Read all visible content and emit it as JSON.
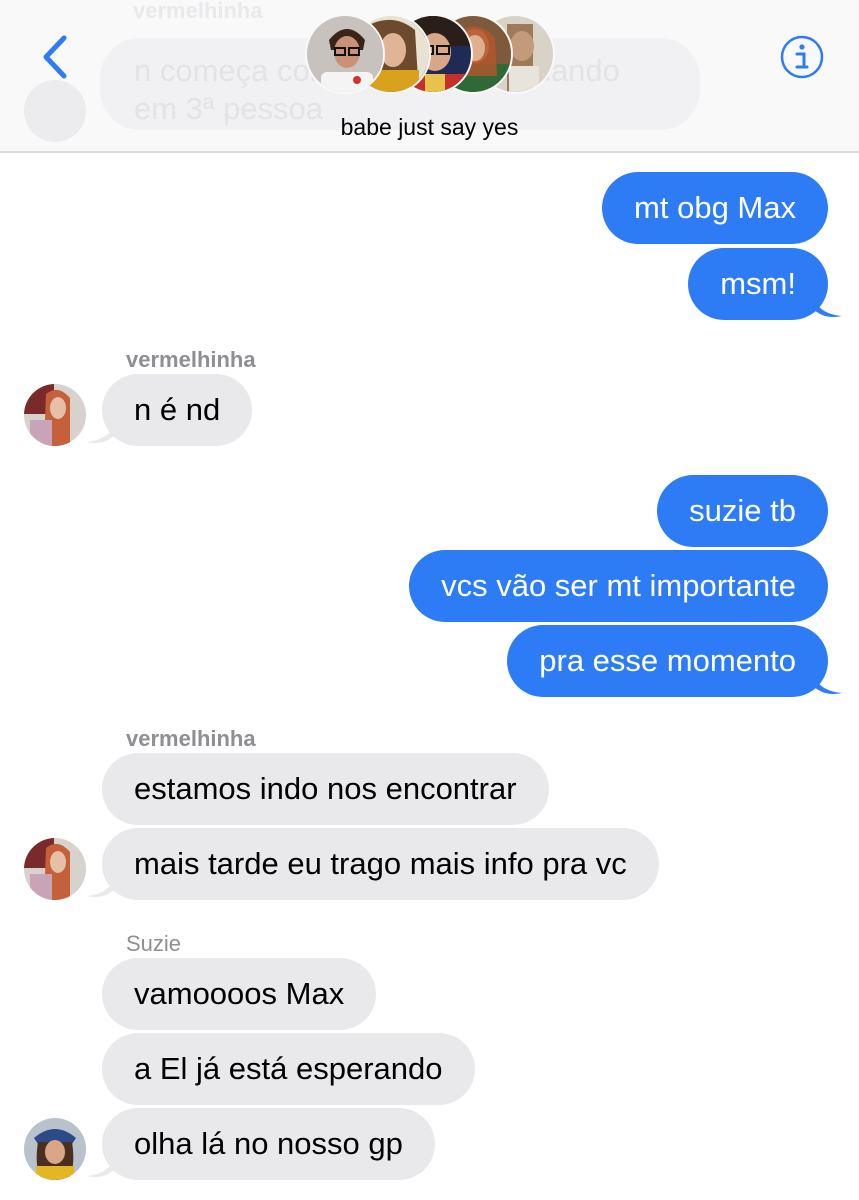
{
  "header": {
    "group_name": "babe just say yes",
    "ghost_sender": "vermelhinha",
    "ghost_text": "n começa com isso de ficar falando em 3ª pessoa"
  },
  "icons": {
    "back": "chevron-left-icon",
    "info": "info-circle-icon"
  },
  "colors": {
    "accent": "#2d7cf6",
    "incoming_bubble": "#e9e9eb",
    "sender_label": "#8e8e93"
  },
  "messages": [
    {
      "direction": "out",
      "text": "mt obg Max"
    },
    {
      "direction": "out",
      "text": "msm!"
    },
    {
      "direction": "in",
      "sender": "vermelhinha",
      "text": "n é nd"
    },
    {
      "direction": "out",
      "text": "suzie tb"
    },
    {
      "direction": "out",
      "text": "vcs vão ser mt importante"
    },
    {
      "direction": "out",
      "text": "pra esse momento"
    },
    {
      "direction": "in",
      "sender": "vermelhinha",
      "text": "estamos indo nos encontrar"
    },
    {
      "direction": "in",
      "text": "mais tarde eu trago mais info pra vc"
    },
    {
      "direction": "in",
      "sender": "Suzie",
      "text": "vamoooos Max"
    },
    {
      "direction": "in",
      "text": "a El já está esperando"
    },
    {
      "direction": "in",
      "text": "olha lá no nosso gp"
    }
  ]
}
